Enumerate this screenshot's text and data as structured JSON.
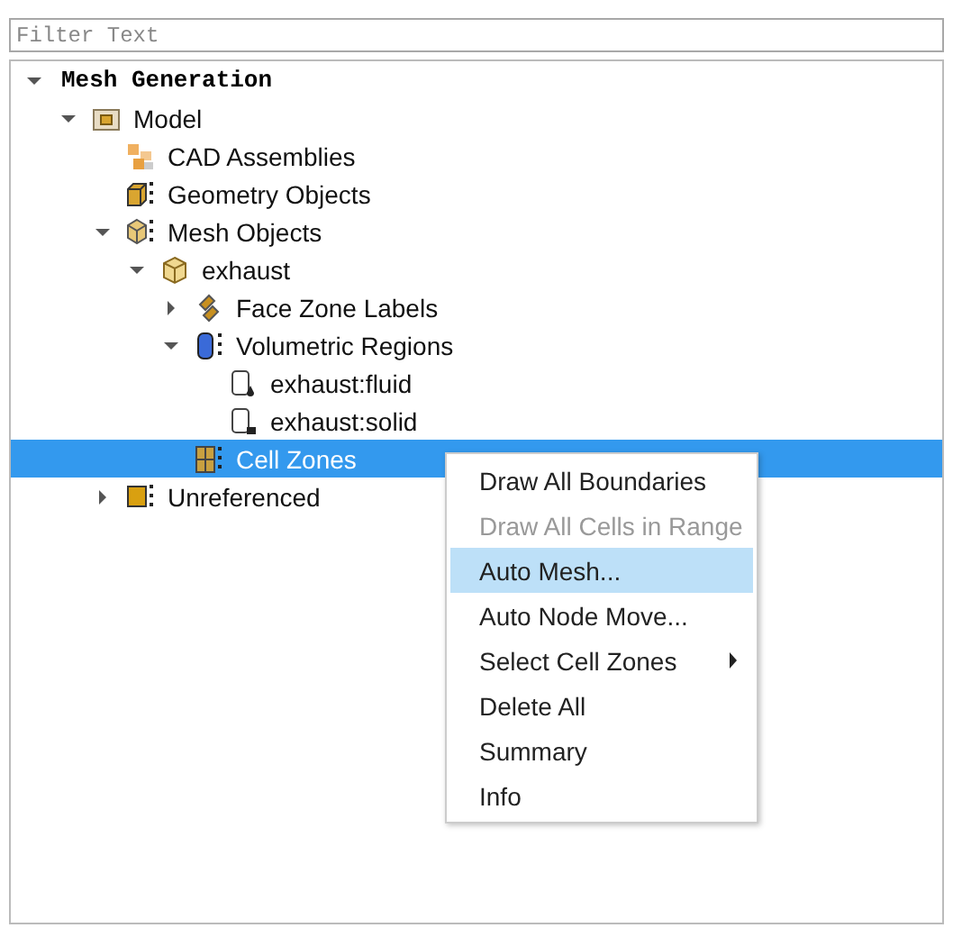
{
  "filter": {
    "placeholder": "Filter Text"
  },
  "tree": [
    {
      "label": "Mesh Generation",
      "kind": "root",
      "expanded": true,
      "selected": false,
      "children": [
        {
          "label": "Model",
          "kind": "folder",
          "expanded": true,
          "selected": false,
          "children": [
            {
              "label": "CAD Assemblies",
              "kind": "assembly",
              "selected": false
            },
            {
              "label": "Geometry Objects",
              "kind": "geometry",
              "selected": false
            },
            {
              "label": "Mesh Objects",
              "kind": "mesh",
              "expanded": true,
              "selected": false,
              "children": [
                {
                  "label": "exhaust",
                  "kind": "part",
                  "expanded": true,
                  "selected": false,
                  "children": [
                    {
                      "label": "Face Zone Labels",
                      "kind": "labels",
                      "expanded": false,
                      "selected": false
                    },
                    {
                      "label": "Volumetric Regions",
                      "kind": "regions",
                      "expanded": true,
                      "selected": false,
                      "children": [
                        {
                          "label": "exhaust:fluid",
                          "kind": "fluid",
                          "selected": false
                        },
                        {
                          "label": "exhaust:solid",
                          "kind": "solid",
                          "selected": false
                        }
                      ]
                    },
                    {
                      "label": "Cell Zones",
                      "kind": "zones",
                      "selected": true
                    }
                  ]
                }
              ]
            },
            {
              "label": "Unreferenced",
              "kind": "unreferenced",
              "expanded": false,
              "selected": false
            }
          ]
        }
      ]
    }
  ],
  "context_menu": [
    {
      "label": "Draw All Boundaries",
      "disabled": false,
      "selected": false,
      "submenu": false
    },
    {
      "label": "Draw All Cells in Range",
      "disabled": true,
      "selected": false,
      "submenu": false
    },
    {
      "label": "Auto Mesh...",
      "disabled": false,
      "selected": true,
      "submenu": false
    },
    {
      "label": "Auto Node Move...",
      "disabled": false,
      "selected": false,
      "submenu": false
    },
    {
      "label": "Select Cell Zones",
      "disabled": false,
      "selected": false,
      "submenu": true
    },
    {
      "label": "Delete All",
      "disabled": false,
      "selected": false,
      "submenu": false
    },
    {
      "label": "Summary",
      "disabled": false,
      "selected": false,
      "submenu": false
    },
    {
      "label": "Info",
      "disabled": false,
      "selected": false,
      "submenu": false
    }
  ]
}
